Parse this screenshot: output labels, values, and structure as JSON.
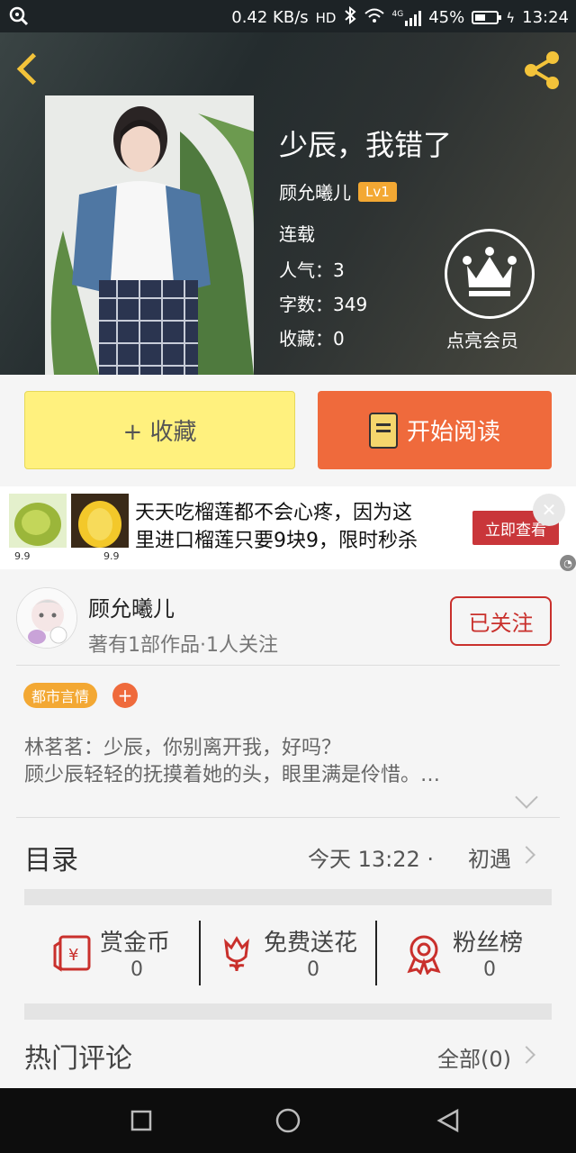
{
  "status_bar": {
    "speed": "0.42 KB/s",
    "network": "HD",
    "signal_label": "4G",
    "battery": "45%",
    "time": "13:24"
  },
  "book": {
    "title": "少辰，我错了",
    "author": "顾允曦儿",
    "level": "Lv1",
    "status": "连载",
    "popularity_label": "人气：",
    "popularity": "3",
    "words_label": "字数：",
    "words": "349",
    "favorites_label": "收藏：",
    "favorites": "0"
  },
  "vip": {
    "label": "点亮会员"
  },
  "actions": {
    "favorite": "+ 收藏",
    "read": "开始阅读"
  },
  "ad": {
    "line1": "天天吃榴莲都不会心疼，因为这",
    "line2": "里进口榴莲只要9块9，限时秒杀",
    "cta": "立即查看",
    "price1": "9.9",
    "price2": "9.9"
  },
  "author_card": {
    "name": "顾允曦儿",
    "sub": "著有1部作品·1人关注",
    "follow": "已关注"
  },
  "tags": {
    "genre": "都市言情",
    "add": "+"
  },
  "synopsis": {
    "line1": "林茗茗：少辰，你别离开我，好吗？",
    "line2": "顾少辰轻轻的抚摸着她的头，眼里满是伶惜。…"
  },
  "toc": {
    "label": "目录",
    "updated": "今天 13:22 ·",
    "chapter": "初遇"
  },
  "stats": [
    {
      "label": "赏金币",
      "value": "0"
    },
    {
      "label": "免费送花",
      "value": "0"
    },
    {
      "label": "粉丝榜",
      "value": "0"
    }
  ],
  "comments": {
    "label": "热门评论",
    "all": "全部(0)"
  },
  "colors": {
    "accent_yellow": "#f3c33a",
    "read_button": "#ef6a3c",
    "favorite_button": "#fff17e",
    "follow_red": "#c9302c",
    "tag_orange": "#f3a833"
  }
}
